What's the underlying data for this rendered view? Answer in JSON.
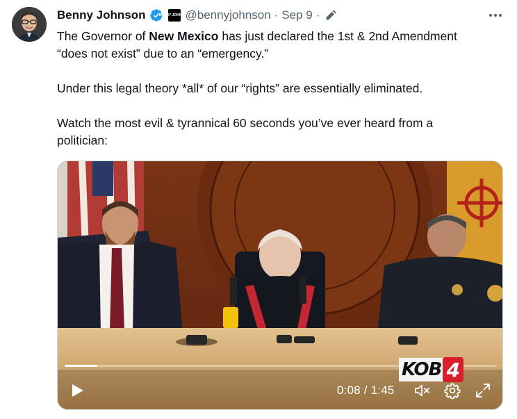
{
  "author": {
    "name": "Benny Johnson",
    "handle": "@bennyjohnson",
    "separator": "·",
    "date": "Sep 9",
    "badge_text": "BENNY JOHNSON",
    "avatar_icon": "profile-photo"
  },
  "tweet": {
    "line1_prefix": "The Governor of ",
    "line1_bold": "New Mexico",
    "line1_suffix": " has just declared the 1st & 2nd Amendment",
    "line2": "“does not exist” due to an “emergency.”",
    "paragraph2": "Under this legal theory *all* of our “rights” are essentially eliminated.",
    "paragraph3_line1": "Watch the most evil & tyrannical 60 seconds you’ve ever heard from a",
    "paragraph3_line2": "politician:"
  },
  "video": {
    "current_time": "0:08",
    "duration": "1:45",
    "time_display": "0:08 / 1:45",
    "progress_percent": 7.6,
    "watermark_text": "KOB",
    "watermark_number": "4",
    "icons": {
      "play": "play-icon",
      "mute": "muted-speaker-icon",
      "settings": "gear-icon",
      "fullscreen": "expand-icon"
    }
  },
  "colors": {
    "text_primary": "#0f1419",
    "text_secondary": "#536471",
    "verified_blue": "#1d9bf0",
    "kob_red": "#d81e2b"
  }
}
